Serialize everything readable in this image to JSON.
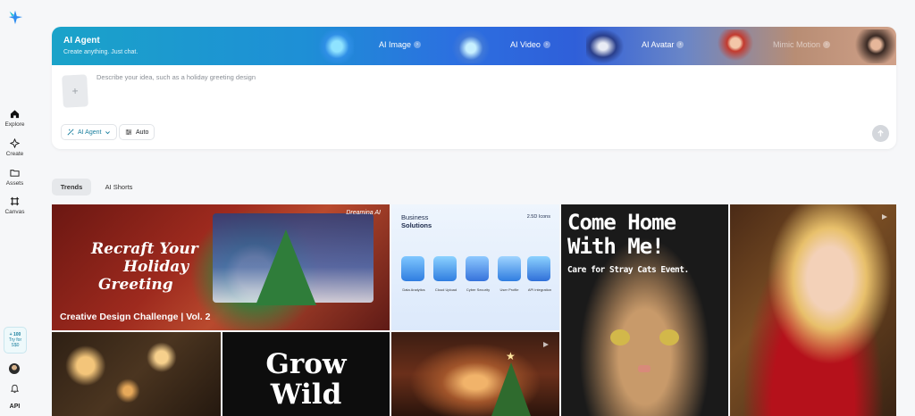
{
  "sidebar": {
    "items": [
      {
        "label": "Explore"
      },
      {
        "label": "Create"
      },
      {
        "label": "Assets"
      },
      {
        "label": "Canvas"
      }
    ],
    "promo": {
      "credits": "+ 100",
      "line1": "Try for",
      "line2": "S$0"
    },
    "api_label": "API"
  },
  "banner": {
    "title": "AI Agent",
    "subtitle": "Create anything. Just chat.",
    "tools": [
      {
        "label": "AI Image"
      },
      {
        "label": "AI Video"
      },
      {
        "label": "AI Avatar"
      },
      {
        "label": "Mimic Motion"
      }
    ]
  },
  "composer": {
    "placeholder": "Describe your idea, such as a holiday greeting design",
    "mode_label": "AI Agent",
    "auto_label": "Auto"
  },
  "tabs": [
    {
      "label": "Trends",
      "active": true
    },
    {
      "label": "AI Shorts",
      "active": false
    }
  ],
  "gallery": {
    "card1": {
      "brand": "Dreamina AI",
      "headline1": "Recraft Your",
      "headline2": "Holiday",
      "headline3": "Greeting",
      "caption": "Creative Design Challenge | Vol. 2"
    },
    "card2": {
      "title1": "Business",
      "title2": "Solutions",
      "badge": "2.5D Icons",
      "icons": [
        "Data Analytics",
        "Cloud Upload",
        "Cyber Security",
        "User Profile",
        "API integration"
      ]
    },
    "card3": {
      "headline1": "Come Home",
      "headline2": "With Me!",
      "sub": "Care for Stray Cats Event."
    },
    "card5": {
      "headline1": "Grow",
      "headline2": "Wild"
    }
  }
}
